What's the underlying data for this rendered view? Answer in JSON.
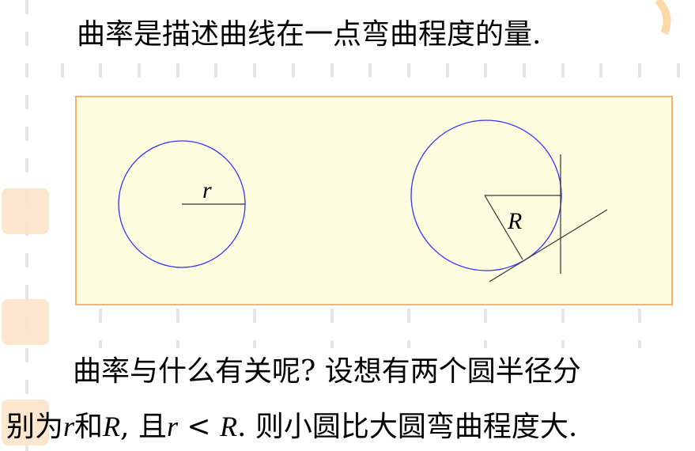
{
  "slide": {
    "title": "曲率是描述曲线在一点弯曲程度的量.",
    "line2": "曲率与什么有关呢? 设想有两个圆半径分",
    "line3_a": "别为",
    "r": "r",
    "line3_b": "和",
    "R": "R",
    "line3_c": ", 且",
    "line3_d": " < ",
    "line3_e": ". 则小圆比大圆弯曲程度大."
  },
  "figure": {
    "small_radius_label": "r",
    "large_radius_label": "R"
  },
  "colors": {
    "circle": "#3333ff",
    "panel_bg": "#fffde0",
    "panel_border": "#f5b36b"
  }
}
